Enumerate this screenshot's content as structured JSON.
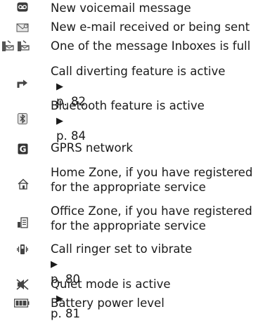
{
  "items": [
    {
      "icon": "voicemail-icon",
      "lines": [
        "New voicemail message"
      ],
      "ref": ""
    },
    {
      "icon": "envelope-icon",
      "lines": [
        "New e-mail received or being sent"
      ],
      "ref": ""
    },
    {
      "icon": "inbox-full-icon",
      "lines": [
        "One of the message Inboxes is full"
      ],
      "ref": ""
    },
    {
      "icon": "call-divert-icon",
      "lines": [
        "Call diverting feature is active"
      ],
      "ref": "p. 82"
    },
    {
      "icon": "bluetooth-icon",
      "lines": [
        "Bluetooth feature is active"
      ],
      "ref": "p. 84"
    },
    {
      "icon": "gprs-icon",
      "lines": [
        "GPRS network"
      ],
      "ref": ""
    },
    {
      "icon": "home-zone-icon",
      "lines": [
        "Home Zone, if you have registered",
        "for the appropriate service"
      ],
      "ref": ""
    },
    {
      "icon": "office-zone-icon",
      "lines": [
        "Office Zone, if you have registered",
        "for the appropriate service"
      ],
      "ref": ""
    },
    {
      "icon": "vibrate-icon",
      "lines": [
        "Call ringer set to vibrate"
      ],
      "ref": "p. 80"
    },
    {
      "icon": "quiet-mode-icon",
      "lines": [
        "Quiet mode is active"
      ],
      "ref": "p. 81"
    },
    {
      "icon": "battery-icon",
      "lines": [
        "Battery power level"
      ],
      "ref": ""
    }
  ],
  "ref_marker": "▶"
}
